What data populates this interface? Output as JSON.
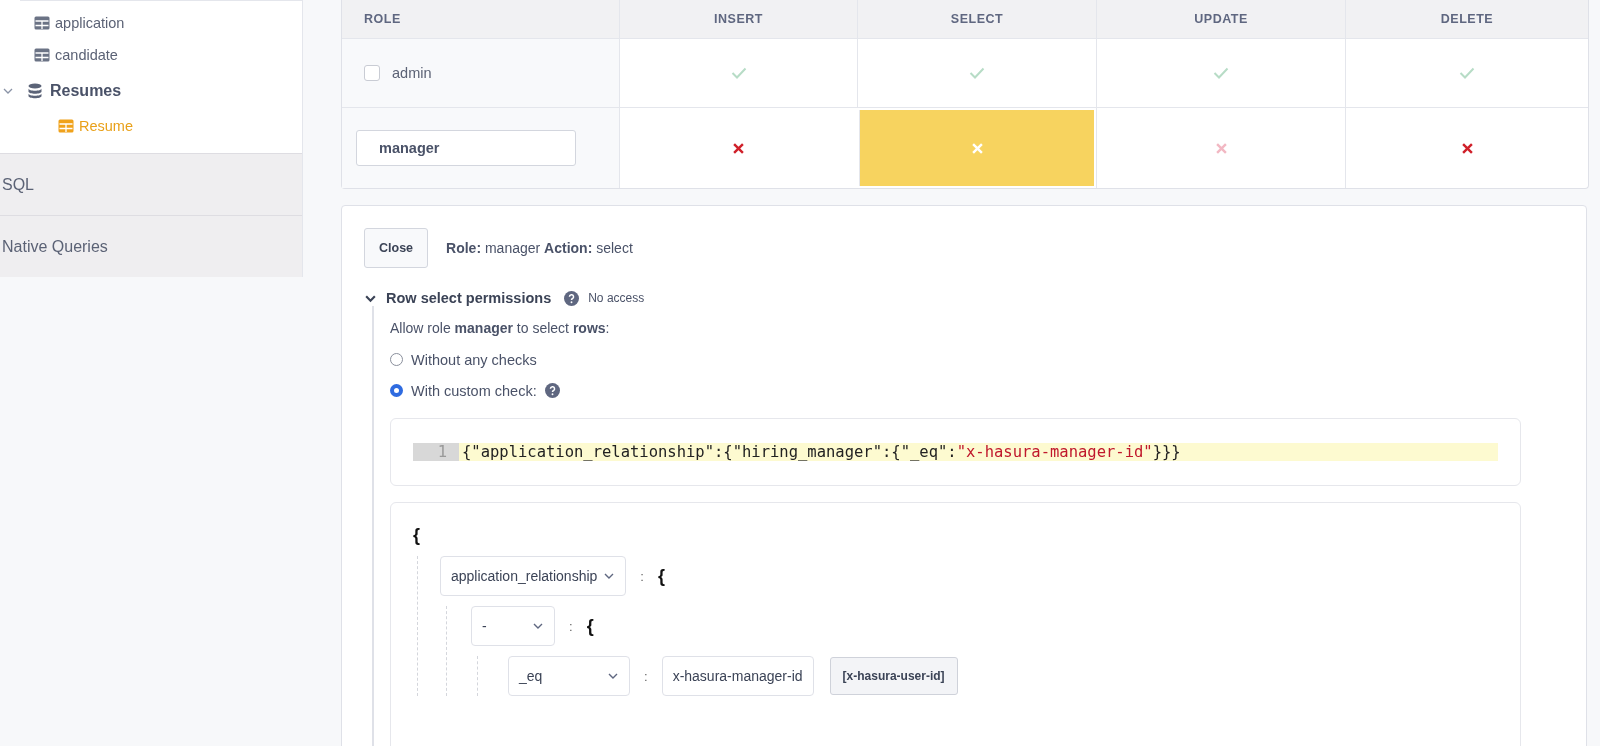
{
  "sidebar": {
    "tree": [
      {
        "label": "application",
        "kind": "table",
        "selected": false
      },
      {
        "label": "candidate",
        "kind": "table",
        "selected": false
      },
      {
        "label": "Resumes",
        "kind": "schema",
        "expanded": true,
        "selected": false,
        "children": [
          {
            "label": "Resume",
            "kind": "table",
            "selected": true
          }
        ]
      }
    ],
    "sections": [
      "SQL",
      "Native Queries"
    ]
  },
  "permissions": {
    "columns": [
      "ROLE",
      "INSERT",
      "SELECT",
      "UPDATE",
      "DELETE"
    ],
    "rows": [
      {
        "role": "admin",
        "kind": "checkbox",
        "checked": false,
        "cells": [
          {
            "allowed": true,
            "selected": false,
            "muted": false
          },
          {
            "allowed": true,
            "selected": false,
            "muted": false
          },
          {
            "allowed": true,
            "selected": false,
            "muted": false
          },
          {
            "allowed": true,
            "selected": false,
            "muted": false
          }
        ]
      },
      {
        "role": "manager",
        "kind": "input",
        "cells": [
          {
            "allowed": false,
            "selected": false,
            "muted": false
          },
          {
            "allowed": false,
            "selected": true,
            "muted": false
          },
          {
            "allowed": false,
            "selected": false,
            "muted": true
          },
          {
            "allowed": false,
            "selected": false,
            "muted": false
          }
        ]
      }
    ]
  },
  "editor": {
    "close_button": "Close",
    "summary": "**Role:** manager **Action:** select",
    "section": {
      "title": "Row select permissions",
      "expanded": true,
      "status": "No access",
      "sentence": "Allow role **manager** to select  **rows**:",
      "options": [
        {
          "label": "Without any checks",
          "selected": false,
          "help": false
        },
        {
          "label": "With custom check:",
          "selected": true,
          "help": true
        }
      ],
      "code": {
        "line_number": "1",
        "tokens": [
          {
            "kind": "punct",
            "text": "{"
          },
          {
            "kind": "key",
            "text": "\"application_relationship\""
          },
          {
            "kind": "punct",
            "text": ":{"
          },
          {
            "kind": "key",
            "text": "\"hiring_manager\""
          },
          {
            "kind": "punct",
            "text": ":{"
          },
          {
            "kind": "key",
            "text": "\"_eq\""
          },
          {
            "kind": "punct",
            "text": ":"
          },
          {
            "kind": "string",
            "text": "\"x-hasura-manager-id\""
          },
          {
            "kind": "punct",
            "text": "}}}"
          }
        ]
      },
      "builder": {
        "open": "{",
        "colon": ":",
        "nodes": [
          {
            "key": "application_relationship",
            "brace": "{",
            "children": [
              {
                "key": "-",
                "brace": "{",
                "children": [
                  {
                    "key": "_eq",
                    "value": "x-hasura-manager-id",
                    "session_button": "[x-hasura-user-id]"
                  }
                ]
              }
            ]
          }
        ]
      }
    }
  }
}
